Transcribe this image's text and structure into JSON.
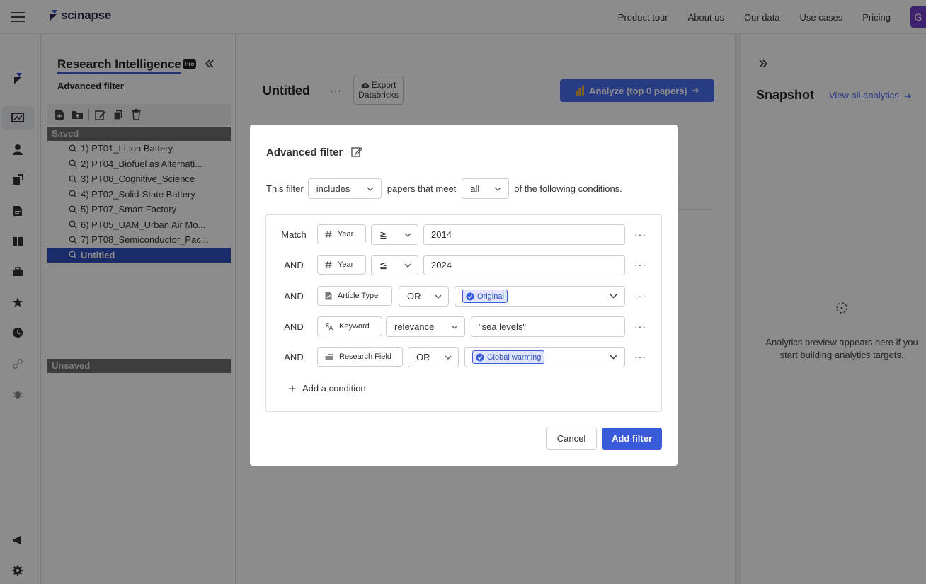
{
  "topbar": {
    "logo_text": "scinapse",
    "nav": [
      "Product tour",
      "About us",
      "Our data",
      "Use cases",
      "Pricing"
    ],
    "user_initial": "G"
  },
  "sidebar": {
    "title": "Research Intelligence",
    "pro_badge": "Pro",
    "subtitle": "Advanced filter",
    "saved_label": "Saved",
    "unsaved_label": "Unsaved",
    "saved_items": [
      "1) PT01_Li-ion Battery",
      "2) PT04_Biofuel as Alternati...",
      "3) PT06_Cognitive_Science",
      "4) PT02_Solid-State Battery",
      "5) PT07_Smart Factory",
      "6) PT05_UAM_Urban Air Mo...",
      "7) PT08_Semiconductor_Pac...",
      "Untitled"
    ],
    "selected_index": 7
  },
  "main": {
    "title": "Untitled",
    "more": "···",
    "export_line1": "Export",
    "export_line2": "Databricks",
    "analyze_label": "Analyze  (top 0 papers)"
  },
  "right": {
    "title": "Snapshot",
    "view_all": "View all analytics",
    "empty_text": "Analytics preview appears here if you start building analytics targets."
  },
  "modal": {
    "title": "Advanced filter",
    "sentence_prefix": "This filter",
    "include_value": "includes",
    "sentence_middle": "papers that meet",
    "meet_value": "all",
    "sentence_suffix": "of the following conditions.",
    "conditions": [
      {
        "connector": "Match",
        "field": "Year",
        "operator": "≧",
        "value": "2014"
      },
      {
        "connector": "AND",
        "field": "Year",
        "operator": "≦",
        "value": "2024"
      },
      {
        "connector": "AND",
        "field": "Article Type",
        "operator": "OR",
        "value": "Original"
      },
      {
        "connector": "AND",
        "field": "Keyword",
        "operator": "relevance",
        "value": "\"sea levels\""
      },
      {
        "connector": "AND",
        "field": "Research Field",
        "operator": "OR",
        "value": "Global warming"
      }
    ],
    "more": "···",
    "add_condition": "Add a condition",
    "cancel": "Cancel",
    "submit": "Add filter"
  },
  "colors": {
    "accent": "#3a5bd9",
    "selected_row": "#2f4fbf",
    "section_header": "#6e6e6e",
    "user_chip": "#6f3fc6"
  }
}
